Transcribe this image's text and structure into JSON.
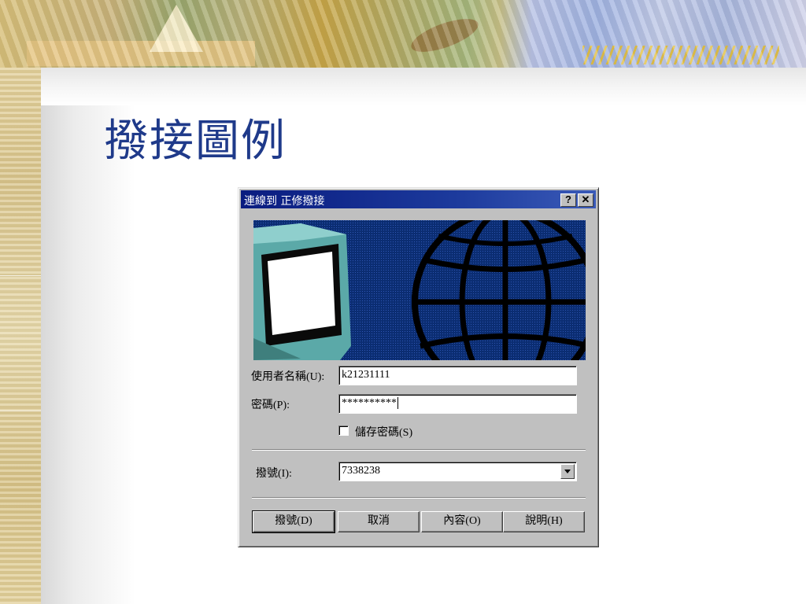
{
  "slide": {
    "title": "撥接圖例"
  },
  "dialog": {
    "title": "連線到 正修撥接",
    "help_label": "?",
    "close_label": "✕",
    "username_label": "使用者名稱(U):",
    "username_value": "k21231111",
    "password_label": "密碼(P):",
    "password_value": "**********",
    "save_password_label": "儲存密碼(S)",
    "save_password_checked": false,
    "dial_label": "撥號(I):",
    "dial_value": "7338238",
    "buttons": {
      "dial": "撥號(D)",
      "cancel": "取消",
      "properties": "內容(O)",
      "help": "說明(H)"
    }
  },
  "colors": {
    "title_text": "#1f3a8a",
    "titlebar": "#0a1c80",
    "dialog_face": "#c0c0c0"
  },
  "icons": {
    "banner": "computer-monitor-and-globe-illustration",
    "dropdown": "chevron-down-icon",
    "checkbox": "checkbox-unchecked"
  }
}
